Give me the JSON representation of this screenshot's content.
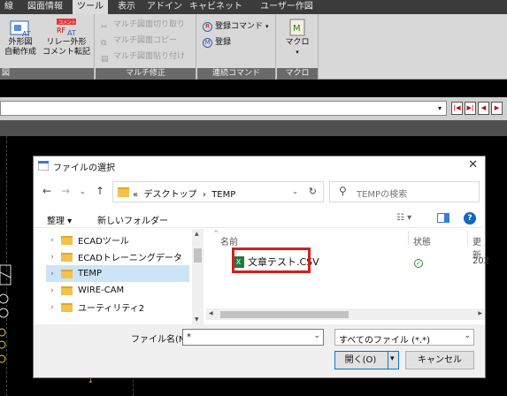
{
  "ribbon": {
    "tabs": [
      "線",
      "図面情報",
      "ツール",
      "表示",
      "アドイン",
      "キャビネット",
      "ユーザー作図"
    ],
    "active_tab": "ツール",
    "btn_gaikeizu": "外形図\n自動作成",
    "btn_relay": "リレー外形\nコメント転記",
    "group_left_label": "図",
    "multi_cut": "マルチ図面切り取り",
    "multi_copy": "マルチ図面コピー",
    "multi_paste": "マルチ図面貼り付け",
    "group_multi_label": "マルチ修正",
    "reg_command": "登録コマンド",
    "register": "登録",
    "group_cont_label": "連続コマンド",
    "macro": "マクロ",
    "group_macro_label": "マクロ",
    "relay_badge": "コメント"
  },
  "dialog": {
    "title": "ファイルの選択",
    "path_prefix": "«",
    "path_part1": "デスクトップ",
    "path_sep": "›",
    "path_part2": "TEMP",
    "search_placeholder": "TEMPの検索",
    "organize": "整理 ▾",
    "new_folder": "新しいフォルダー",
    "tree": [
      "ECADツール",
      "ECADトレーニングデータ",
      "TEMP",
      "WIRE-CAM",
      "ユーティリティ2"
    ],
    "selected_tree": "TEMP",
    "col_name": "名前",
    "col_status": "状態",
    "col_updated": "更新",
    "file_name": "文章テスト.CSV",
    "file_date_prefix": "202",
    "filename_label": "ファイル名(N):",
    "filename_value": "*",
    "filetype_value": "すべてのファイル (*.*)",
    "open_button": "開く(O)",
    "cancel_button": "キャンセル"
  },
  "colors": {
    "highlight": "#d0201d",
    "selection": "#cce4f7",
    "accent": "#0078d7"
  }
}
